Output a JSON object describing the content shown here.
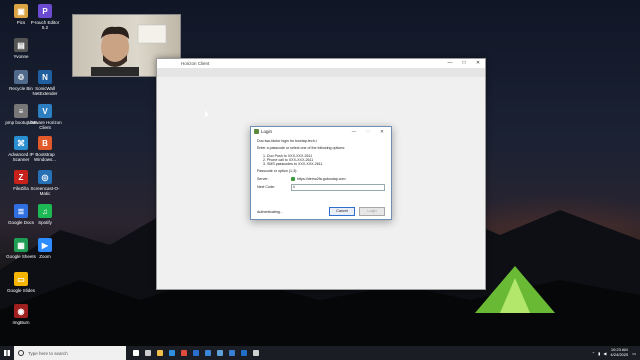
{
  "desktop_icons": [
    {
      "label": "Pics",
      "color": "#d9a441",
      "glyph": "▣"
    },
    {
      "label": "P-touch Editor 5.2",
      "color": "#6a4bd0",
      "glyph": "P"
    },
    {
      "label": "Yvonne",
      "color": "#555555",
      "glyph": "▤"
    },
    {
      "label": "Recycle Bin",
      "color": "#4f6a8a",
      "glyph": "♲"
    },
    {
      "label": "SonicWall NetExtender",
      "color": "#1f5fa0",
      "glyph": "N"
    },
    {
      "label": "pmp bootup.bat",
      "color": "#777777",
      "glyph": "≡"
    },
    {
      "label": "VMware Horizon Client",
      "color": "#2d7fc1",
      "glyph": "V"
    },
    {
      "label": "Advanced IP Scanner",
      "color": "#2a8fd0",
      "glyph": "⌘"
    },
    {
      "label": "Bootstrap Windows...",
      "color": "#e25a2a",
      "glyph": "B"
    },
    {
      "label": "FileZilla",
      "color": "#c8211b",
      "glyph": "Z"
    },
    {
      "label": "Screencast-O-Matic",
      "color": "#2670b6",
      "glyph": "◎"
    },
    {
      "label": "Google Docs",
      "color": "#2f6fe0",
      "glyph": "≣"
    },
    {
      "label": "Spotify",
      "color": "#1db954",
      "glyph": "♫"
    },
    {
      "label": "Google Sheets",
      "color": "#1f9d55",
      "glyph": "▦"
    },
    {
      "label": "Zoom",
      "color": "#2d8cff",
      "glyph": "▶"
    },
    {
      "label": "Google Slides",
      "color": "#f4b400",
      "glyph": "▭"
    },
    {
      "label": "ImgBurn",
      "color": "#a02020",
      "glyph": "◉"
    }
  ],
  "main_window": {
    "title": "Horizon Client",
    "min": "—",
    "max": "□",
    "close": "✕"
  },
  "dialog": {
    "title": "Login",
    "min": "—",
    "max": "□",
    "close": "✕",
    "intro": "Duo two-factor login for bowtap-tech-i",
    "prompt": "Enter a passcode or select one of the following options:",
    "options": [
      "1. Duo Push to XXX-XXX-2611",
      "2. Phone call to XXX-XXX-2611",
      "3. SMS passcodes to XXX-XXX-2611"
    ],
    "passcode_hint": "Passcode or option (1-3):",
    "server_label": "Server:",
    "server_value": "https://demo2fa.gobootap.com",
    "next_code_label": "Next Code:",
    "next_code_value": "4",
    "status": "Authenticating...",
    "cancel_label": "Cancel",
    "login_label": "Login"
  },
  "taskbar": {
    "search_placeholder": "Type here to search",
    "time": "10:23 AM",
    "date": "4/24/2020",
    "pinned": [
      {
        "name": "cortana-icon",
        "color": "#ffffff"
      },
      {
        "name": "task-view-icon",
        "color": "#cccccc"
      },
      {
        "name": "file-explorer-icon",
        "color": "#f2c04a"
      },
      {
        "name": "edge-icon",
        "color": "#2f8fe0"
      },
      {
        "name": "chrome-icon",
        "color": "#e24b3b"
      },
      {
        "name": "mail-icon",
        "color": "#2a6fd0"
      },
      {
        "name": "store-icon",
        "color": "#3a85d8"
      },
      {
        "name": "vmware-icon",
        "color": "#5ea0d8"
      },
      {
        "name": "screencast-icon",
        "color": "#3a7fd0"
      },
      {
        "name": "outlook-icon",
        "color": "#1f6fc8"
      },
      {
        "name": "settings-icon",
        "color": "#d0d0d0"
      }
    ]
  }
}
